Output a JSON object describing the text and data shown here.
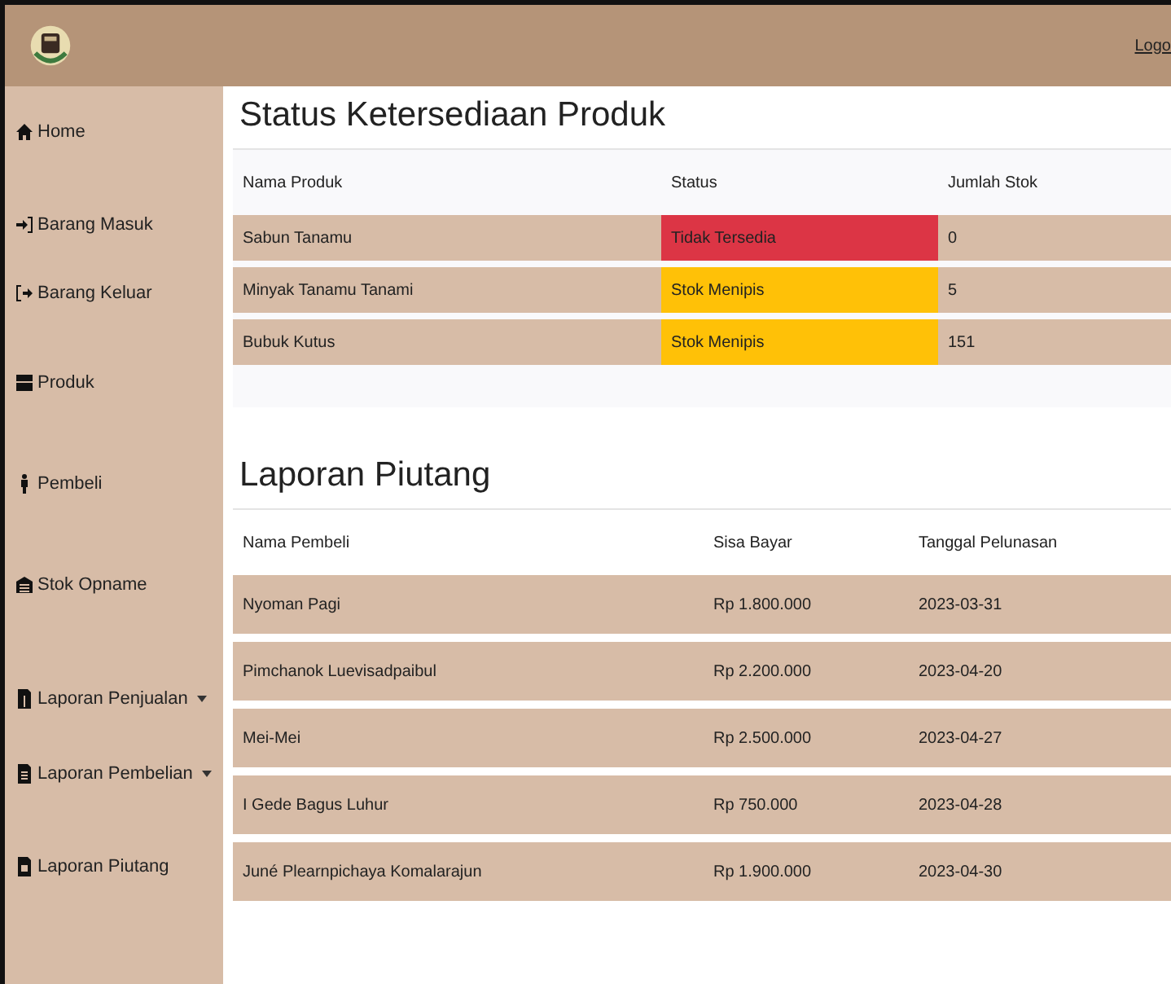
{
  "header": {
    "logout": "Logo"
  },
  "sidebar": {
    "items": [
      {
        "label": "Home",
        "dropdown": false
      },
      {
        "label": "Barang Masuk",
        "dropdown": false
      },
      {
        "label": "Barang Keluar",
        "dropdown": false
      },
      {
        "label": "Produk",
        "dropdown": false
      },
      {
        "label": "Pembeli",
        "dropdown": false
      },
      {
        "label": "Stok Opname",
        "dropdown": false
      },
      {
        "label": "Laporan Penjualan",
        "dropdown": true
      },
      {
        "label": "Laporan Pembelian",
        "dropdown": true
      },
      {
        "label": "Laporan Piutang",
        "dropdown": false
      }
    ]
  },
  "stock": {
    "title": "Status Ketersediaan Produk",
    "columns": [
      "Nama Produk",
      "Status",
      "Jumlah Stok"
    ],
    "rows": [
      {
        "name": "Sabun Tanamu",
        "status": "Tidak Tersedia",
        "color": "#dc3545",
        "stock": "0"
      },
      {
        "name": "Minyak Tanamu Tanami",
        "status": "Stok Menipis",
        "color": "#ffc107",
        "stock": "5"
      },
      {
        "name": "Bubuk Kutus",
        "status": "Stok Menipis",
        "color": "#ffc107",
        "stock": "151"
      }
    ]
  },
  "receivables": {
    "title": "Laporan Piutang",
    "columns": [
      "Nama Pembeli",
      "Sisa Bayar",
      "Tanggal Pelunasan"
    ],
    "rows": [
      {
        "name": "Nyoman Pagi",
        "remaining": "Rp 1.800.000",
        "date": "2023-03-31"
      },
      {
        "name": "Pimchanok Luevisadpaibul",
        "remaining": "Rp 2.200.000",
        "date": "2023-04-20"
      },
      {
        "name": "Mei-Mei",
        "remaining": "Rp 2.500.000",
        "date": "2023-04-27"
      },
      {
        "name": "I Gede Bagus Luhur",
        "remaining": "Rp 750.000",
        "date": "2023-04-28"
      },
      {
        "name": "Juné Plearnpichaya Komalarajun",
        "remaining": "Rp 1.900.000",
        "date": "2023-04-30"
      }
    ]
  }
}
